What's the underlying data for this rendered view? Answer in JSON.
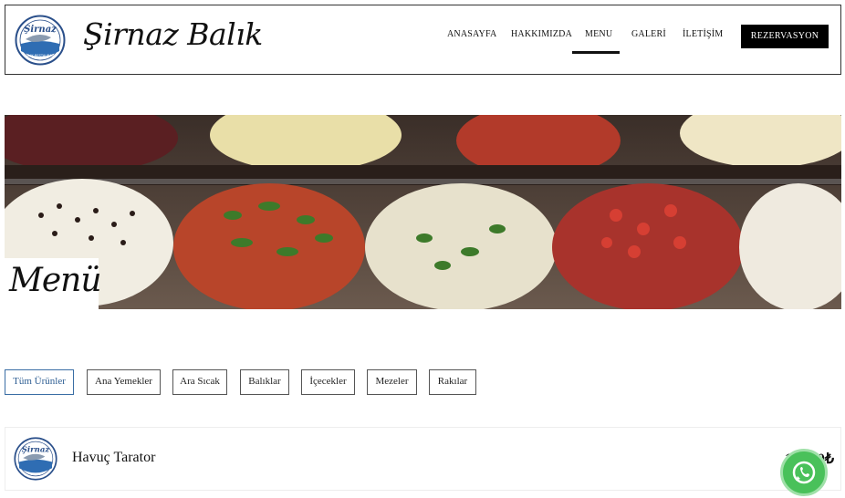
{
  "brand": {
    "name": "Şirnaz Balık",
    "logo_top_text": "Şirnaz",
    "logo_bottom_text": "BALIK RESTAURANT"
  },
  "nav": {
    "items": [
      "ANASAYFA",
      "HAKKIMIZDA",
      "MENU",
      "GALERİ",
      "İLETİŞİM"
    ],
    "active": "MENU",
    "reservation_label": "REZERVASYON"
  },
  "hero": {
    "label": "Menü"
  },
  "filters": {
    "items": [
      "Tüm Ürünler",
      "Ana Yemekler",
      "Ara Sıcak",
      "Balıklar",
      "İçecekler",
      "Mezeler",
      "Rakılar"
    ],
    "active": "Tüm Ürünler"
  },
  "menu_items": [
    {
      "name": "Havuç Tarator",
      "price": "120,00₺"
    }
  ],
  "colors": {
    "active_filter": "#2f5f94",
    "whatsapp": "#49c15a",
    "reservation_bg": "#000000"
  },
  "icons": [
    "whatsapp-icon"
  ]
}
